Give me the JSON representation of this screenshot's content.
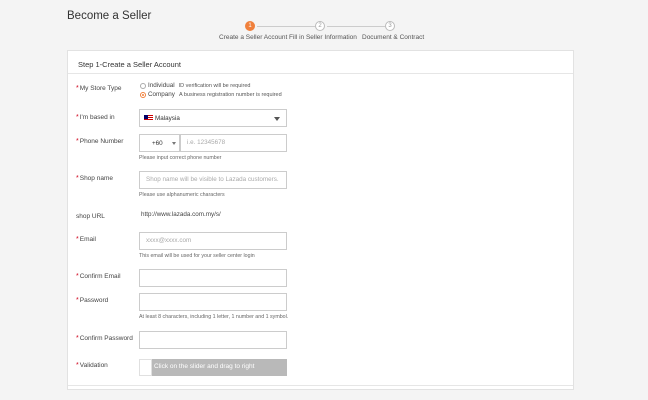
{
  "page": {
    "title": "Become a Seller"
  },
  "steps": [
    {
      "number": "1",
      "label": "Create a Seller Account",
      "active": true
    },
    {
      "number": "2",
      "label": "Fill in Seller Information",
      "active": false
    },
    {
      "number": "3",
      "label": "Document & Contract",
      "active": false
    }
  ],
  "form": {
    "title": "Step 1-Create a Seller Account",
    "store_type": {
      "label": "My Store Type",
      "options": [
        {
          "label": "Individual",
          "note": "ID verification will be required",
          "checked": false
        },
        {
          "label": "Company",
          "note": "A business registration number is required",
          "checked": true
        }
      ]
    },
    "based_in": {
      "label": "I'm based in",
      "value": "Malaysia"
    },
    "phone": {
      "label": "Phone Number",
      "prefix": "+60",
      "placeholder": "i.e. 12345678",
      "hint": "Please input correct phone number"
    },
    "shop_name": {
      "label": "Shop name",
      "placeholder": "Shop name will be visible to Lazada customers.",
      "hint": "Please use alphanumeric characters"
    },
    "shop_url": {
      "label": "shop URL",
      "value": "http://www.lazada.com.my/s/"
    },
    "email": {
      "label": "Email",
      "placeholder": "xxxx@xxxx.com",
      "hint": "This email will be used for your seller center login"
    },
    "confirm_email": {
      "label": "Confirm Email"
    },
    "password": {
      "label": "Password",
      "hint": "At least 8 characters, including 1 letter, 1 number and 1 symbol."
    },
    "confirm_password": {
      "label": "Confirm Password"
    },
    "validation": {
      "label": "Validation",
      "slider_text": "Click on the slider and drag to right"
    }
  },
  "required_marker": "*",
  "colors": {
    "accent": "#f0803c",
    "required": "#d0021b",
    "slider": "#b9b9b9"
  }
}
